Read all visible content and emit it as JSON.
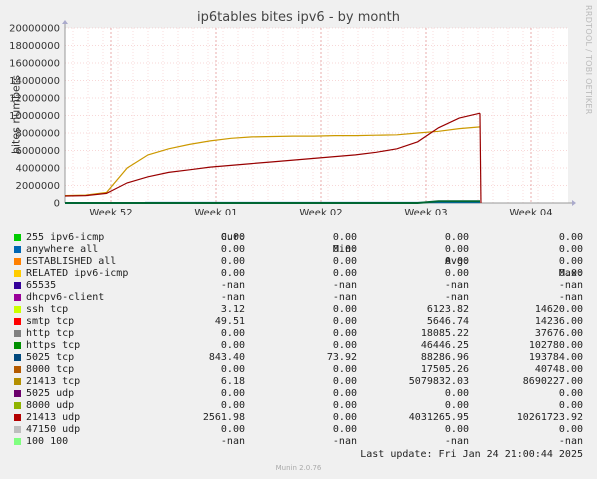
{
  "chart_data": {
    "type": "line",
    "title": "ip6tables bites ipv6 - by month",
    "ylabel": "bites numbers",
    "ylim": [
      0,
      20000000
    ],
    "yticks": [
      "0",
      "2000000",
      "4000000",
      "6000000",
      "8000000",
      "10000000",
      "12000000",
      "14000000",
      "16000000",
      "18000000",
      "20000000"
    ],
    "xticks": [
      "Week 52",
      "Week 01",
      "Week 02",
      "Week 03",
      "Week 04"
    ],
    "xpos": [
      0,
      0.05,
      0.1,
      0.15,
      0.2,
      0.25,
      0.3,
      0.35,
      0.4,
      0.45,
      0.5,
      0.55,
      0.6,
      0.65,
      0.7,
      0.75,
      0.8,
      0.85,
      0.9,
      0.95,
      1.0
    ],
    "series": [
      {
        "name": "21413 tcp",
        "color": "#cc9900",
        "values": [
          850000,
          900000,
          1200000,
          4000000,
          5500000,
          6200000,
          6700000,
          7100000,
          7400000,
          7550000,
          7600000,
          7650000,
          7650000,
          7700000,
          7700000,
          7750000,
          7800000,
          8000000,
          8200000,
          8500000,
          8700000
        ]
      },
      {
        "name": "21413 udp",
        "color": "#990000",
        "values": [
          800000,
          850000,
          1100000,
          2300000,
          3000000,
          3500000,
          3800000,
          4100000,
          4300000,
          4500000,
          4700000,
          4900000,
          5100000,
          5300000,
          5500000,
          5800000,
          6200000,
          7000000,
          8600000,
          9700000,
          10261723
        ]
      },
      {
        "name": "5025 tcp",
        "color": "#006633",
        "values": [
          0,
          0,
          0,
          0,
          0,
          0,
          0,
          0,
          0,
          0,
          0,
          0,
          0,
          0,
          0,
          0,
          0,
          0,
          190000,
          190000,
          190000
        ]
      }
    ],
    "x_end_fraction": 0.825
  },
  "legend": {
    "headers": {
      "cur": "Cur:",
      "min": "Min:",
      "avg": "Avg:",
      "max": "Max:"
    },
    "rows": [
      {
        "name": "255 ipv6-icmp",
        "color": "#00cc00",
        "cur": "0.00",
        "min": "0.00",
        "avg": "0.00",
        "max": "0.00"
      },
      {
        "name": "anywhere all",
        "color": "#0066b3",
        "cur": "0.00",
        "min": "0.00",
        "avg": "0.00",
        "max": "0.00"
      },
      {
        "name": "ESTABLISHED all",
        "color": "#ff8000",
        "cur": "0.00",
        "min": "0.00",
        "avg": "0.00",
        "max": "0.00"
      },
      {
        "name": "RELATED ipv6-icmp",
        "color": "#ffcc00",
        "cur": "0.00",
        "min": "0.00",
        "avg": "0.00",
        "max": "0.00"
      },
      {
        "name": "65535",
        "color": "#330099",
        "cur": "-nan",
        "min": "-nan",
        "avg": "-nan",
        "max": "-nan"
      },
      {
        "name": "dhcpv6-client",
        "color": "#990099",
        "cur": "-nan",
        "min": "-nan",
        "avg": "-nan",
        "max": "-nan"
      },
      {
        "name": "ssh tcp",
        "color": "#ccff00",
        "cur": "3.12",
        "min": "0.00",
        "avg": "6123.82",
        "max": "14620.00"
      },
      {
        "name": "smtp tcp",
        "color": "#ff0000",
        "cur": "49.51",
        "min": "0.00",
        "avg": "5646.74",
        "max": "14236.00"
      },
      {
        "name": "http tcp",
        "color": "#808080",
        "cur": "0.00",
        "min": "0.00",
        "avg": "18085.22",
        "max": "37676.00"
      },
      {
        "name": "https tcp",
        "color": "#008f00",
        "cur": "0.00",
        "min": "0.00",
        "avg": "46446.25",
        "max": "102780.00"
      },
      {
        "name": "5025 tcp",
        "color": "#00487d",
        "cur": "843.40",
        "min": "73.92",
        "avg": "88286.96",
        "max": "193784.00"
      },
      {
        "name": "8000 tcp",
        "color": "#b35a00",
        "cur": "0.00",
        "min": "0.00",
        "avg": "17505.26",
        "max": "40748.00"
      },
      {
        "name": "21413 tcp",
        "color": "#b38f00",
        "cur": "6.18",
        "min": "0.00",
        "avg": "5079832.03",
        "max": "8690227.00"
      },
      {
        "name": "5025 udp",
        "color": "#6b006b",
        "cur": "0.00",
        "min": "0.00",
        "avg": "0.00",
        "max": "0.00"
      },
      {
        "name": "8000 udp",
        "color": "#8fb300",
        "cur": "0.00",
        "min": "0.00",
        "avg": "0.00",
        "max": "0.00"
      },
      {
        "name": "21413 udp",
        "color": "#b30000",
        "cur": "2561.98",
        "min": "0.00",
        "avg": "4031265.95",
        "max": "10261723.92"
      },
      {
        "name": "47150 udp",
        "color": "#bebebe",
        "cur": "0.00",
        "min": "0.00",
        "avg": "0.00",
        "max": "0.00"
      },
      {
        "name": "100 100",
        "color": "#80ff80",
        "cur": "-nan",
        "min": "-nan",
        "avg": "-nan",
        "max": "-nan"
      }
    ]
  },
  "last_update": "Last update: Fri Jan 24 21:00:44 2025",
  "side_text": "RRDTOOL / TOBI OETIKER",
  "footer": "Munin 2.0.76"
}
